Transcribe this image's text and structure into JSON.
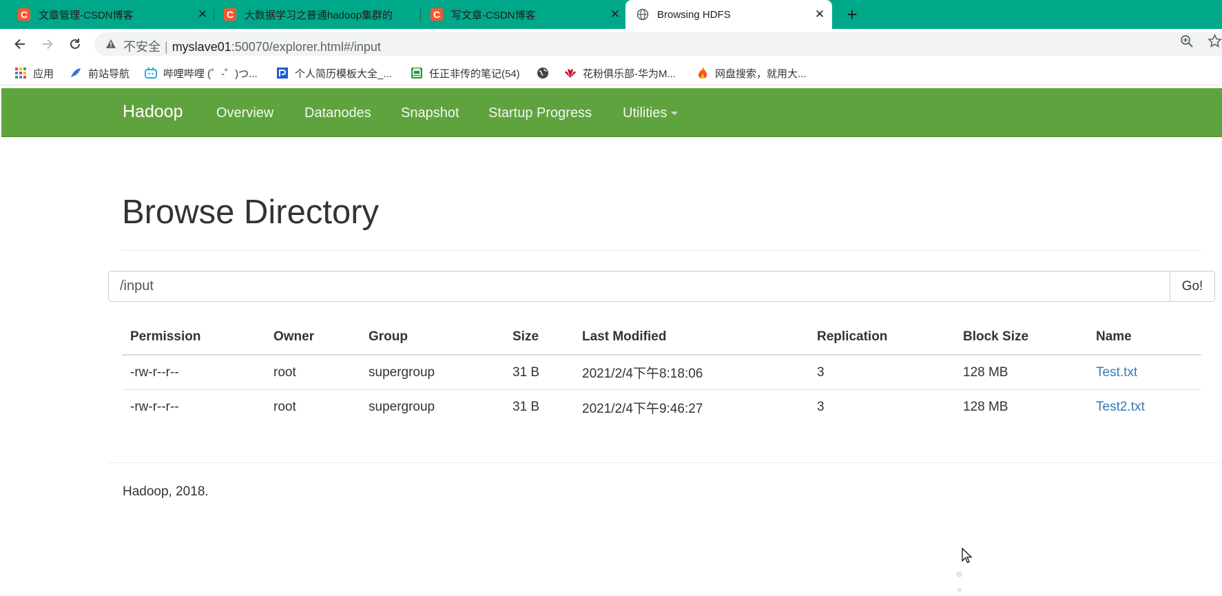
{
  "browser": {
    "tabs": [
      {
        "title": "文章管理-CSDN博客",
        "favicon": "csdn-icon"
      },
      {
        "title": "大数据学习之普通hadoop集群的",
        "favicon": "csdn-icon"
      },
      {
        "title": "写文章-CSDN博客",
        "favicon": "csdn-icon"
      },
      {
        "title": "Browsing HDFS",
        "favicon": "globe-icon",
        "active": true
      }
    ],
    "new_tab": "+",
    "close_glyph": "✕",
    "url": {
      "security": "不安全",
      "separator": "|",
      "host": "myslave01",
      "path": ":50070/explorer.html#/input"
    },
    "bookmarks": [
      {
        "label": "应用",
        "icon": "apps-icon"
      },
      {
        "label": "前站导航",
        "icon": "feather-icon"
      },
      {
        "label": "哔哩哔哩 (゜-゜)つ...",
        "icon": "bilibili-icon"
      },
      {
        "label": "个人简历模板大全_...",
        "icon": "resume-icon"
      },
      {
        "label": "任正非传的笔记(54)",
        "icon": "douban-icon"
      },
      {
        "label": "",
        "icon": "globe-icon"
      },
      {
        "label": "花粉俱乐部-华为M...",
        "icon": "huawei-icon"
      },
      {
        "label": "网盘搜索，就用大...",
        "icon": "fire-icon"
      }
    ]
  },
  "navbar": {
    "brand": "Hadoop",
    "links": [
      "Overview",
      "Datanodes",
      "Snapshot",
      "Startup Progress",
      "Utilities"
    ],
    "color": "#5fa33e"
  },
  "page": {
    "title": "Browse Directory",
    "path_value": "/input",
    "go_label": "Go!"
  },
  "table": {
    "headers": [
      "Permission",
      "Owner",
      "Group",
      "Size",
      "Last Modified",
      "Replication",
      "Block Size",
      "Name"
    ],
    "rows": [
      [
        "-rw-r--r--",
        "root",
        "supergroup",
        "31 B",
        "2021/2/4下午8:18:06",
        "3",
        "128 MB",
        "Test.txt"
      ],
      [
        "-rw-r--r--",
        "root",
        "supergroup",
        "31 B",
        "2021/2/4下午9:46:27",
        "3",
        "128 MB",
        "Test2.txt"
      ]
    ]
  },
  "footer": {
    "text": "Hadoop, 2018."
  },
  "colors": {
    "tabbar": "#00a88a",
    "link": "#337ab7"
  }
}
